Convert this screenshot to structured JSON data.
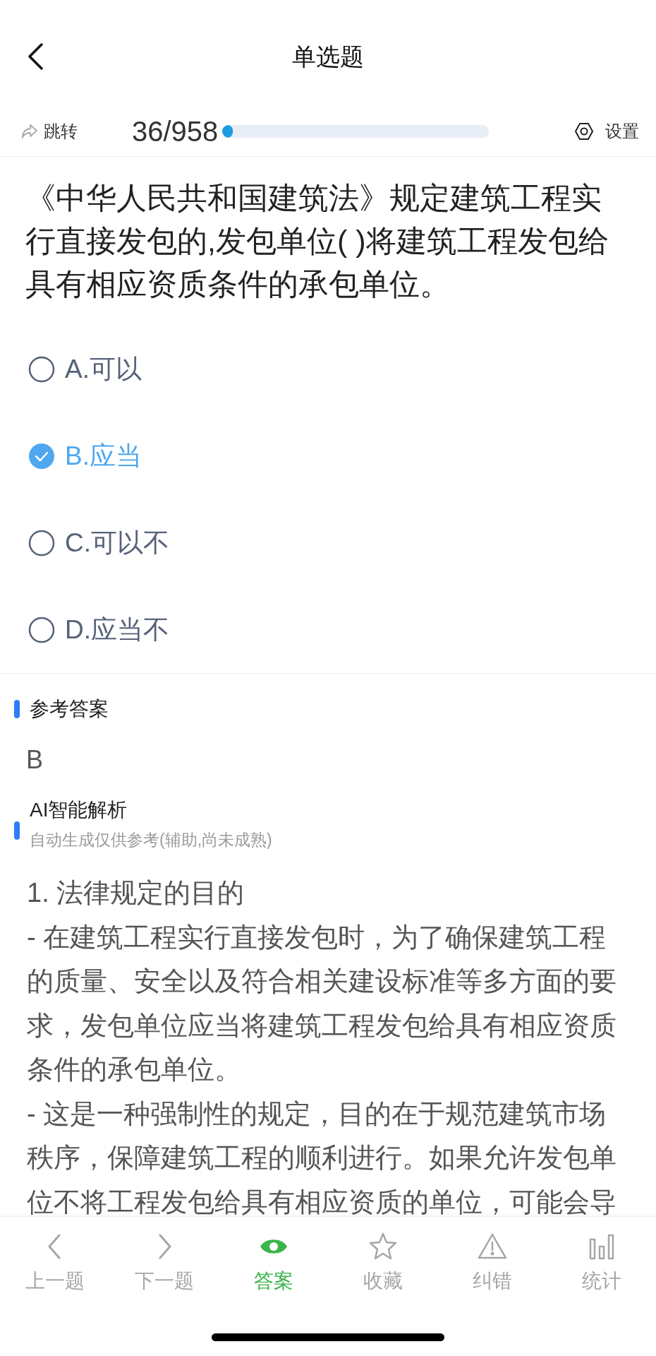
{
  "header": {
    "title": "单选题"
  },
  "toolbar": {
    "jump_label": "跳转",
    "progress_text": "36/958",
    "progress": {
      "level": 0.038
    },
    "settings_label": "设置"
  },
  "question": {
    "text": "《中华人民共和国建筑法》规定建筑工程实行直接发包的,发包单位( )将建筑工程发包给具有相应资质条件的承包单位。"
  },
  "options": [
    {
      "label": "A.可以",
      "selected": false
    },
    {
      "label": "B.应当",
      "selected": true
    },
    {
      "label": "C.可以不",
      "selected": false
    },
    {
      "label": "D.应当不",
      "selected": false
    }
  ],
  "answer_section": {
    "title": "参考答案",
    "answer": "B"
  },
  "analysis_section": {
    "title": "AI智能解析",
    "subtitle": "自动生成仅供参考(辅助,尚未成熟)",
    "paragraphs": [
      "1. 法律规定的目的",
      "- 在建筑工程实行直接发包时，为了确保建筑工程的质量、安全以及符合相关建设标准等多方面的要求，发包单位应当将建筑工程发包给具有相应资质条件的承包单位。",
      "- 这是一种强制性的规定，目的在于规范建筑市场秩序，保障建筑工程的顺利进行。如果允许发包单位不将工程发包给具有相应资质的单位，可能会导"
    ]
  },
  "bottom_nav": [
    {
      "label": "上一题",
      "kind": "prev",
      "selected": false
    },
    {
      "label": "下一题",
      "kind": "next",
      "selected": false
    },
    {
      "label": "答案",
      "kind": "eye",
      "selected": true
    },
    {
      "label": "收藏",
      "kind": "star",
      "selected": false
    },
    {
      "label": "纠错",
      "kind": "warning",
      "selected": false
    },
    {
      "label": "统计",
      "kind": "stats",
      "selected": false
    }
  ]
}
